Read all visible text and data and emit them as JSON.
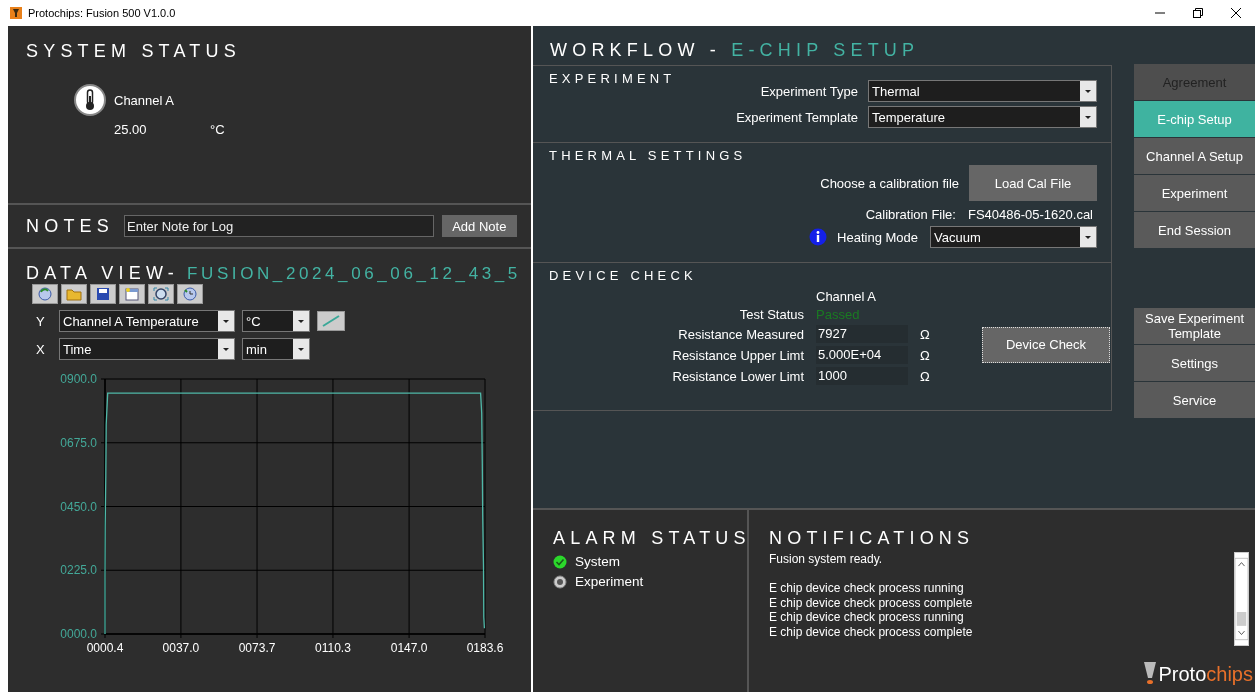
{
  "window": {
    "title": "Protochips: Fusion 500 V1.0.0"
  },
  "system_status": {
    "title": "SYSTEM STATUS",
    "channels": [
      {
        "name": "Channel A",
        "value": "25.00",
        "unit": "°C"
      }
    ]
  },
  "notes": {
    "title": "NOTES",
    "placeholder": "Enter Note for Log",
    "button": "Add Note"
  },
  "data_view": {
    "title": "DATA VIEW-",
    "file": "FUSION_2024_06_06_12_43_5",
    "y_axis": {
      "label": "Y",
      "quantity": "Channel A Temperature",
      "unit": "°C"
    },
    "x_axis": {
      "label": "X",
      "quantity": "Time",
      "unit": "min"
    },
    "chart_data": {
      "type": "line",
      "x": [
        0.4,
        0.4,
        0.5,
        0.8,
        1.0,
        1.7,
        181.5,
        182.0,
        182.3,
        182.5,
        182.9,
        183.0,
        183.3
      ],
      "grid": true,
      "series": [
        {
          "color": "#4fb8a8",
          "values": [
            0,
            200,
            380,
            560,
            740,
            850,
            850,
            780,
            600,
            420,
            240,
            60,
            20
          ]
        }
      ],
      "xlim": [
        0.4,
        183.6
      ],
      "ylim": [
        0,
        900
      ],
      "xticks": [
        {
          "value": 0.4,
          "label": "0000.4"
        },
        {
          "value": 37.0,
          "label": "0037.0"
        },
        {
          "value": 73.7,
          "label": "0073.7"
        },
        {
          "value": 110.3,
          "label": "0110.3"
        },
        {
          "value": 147.0,
          "label": "0147.0"
        },
        {
          "value": 183.6,
          "label": "0183.6"
        }
      ],
      "yticks": [
        {
          "value": 0,
          "label": "0000.0"
        },
        {
          "value": 225,
          "label": "0225.0"
        },
        {
          "value": 450,
          "label": "0450.0"
        },
        {
          "value": 675,
          "label": "0675.0"
        },
        {
          "value": 900,
          "label": "0900.0"
        }
      ]
    }
  },
  "workflow": {
    "title": "WORKFLOW - ",
    "step": "E-CHIP SETUP",
    "experiment": {
      "title": "EXPERIMENT",
      "fields": [
        {
          "label": "Experiment Type",
          "value": "Thermal"
        },
        {
          "label": "Experiment Template",
          "value": "Temperature"
        }
      ]
    },
    "thermal": {
      "title": "THERMAL SETTINGS",
      "prompt": "Choose a calibration file",
      "button": "Load Cal File",
      "file_label": "Calibration File:",
      "file": "FS40486-05-1620.cal",
      "mode_label": "Heating Mode",
      "mode": "Vacuum"
    },
    "device_check": {
      "title": "DEVICE CHECK",
      "channel": "Channel A",
      "status_label": "Test Status",
      "status": {
        "text": "Passed",
        "passed": true
      },
      "readings": [
        {
          "label": "Resistance Measured",
          "value": "7927",
          "unit": "Ω"
        },
        {
          "label": "Resistance Upper Limt",
          "value": "5.000E+04",
          "unit": "Ω"
        },
        {
          "label": "Resistance Lower Limt",
          "value": "1000",
          "unit": "Ω"
        }
      ],
      "button": "Device Check"
    }
  },
  "steps": [
    {
      "label": "Agreement",
      "selected": false,
      "disabled": true
    },
    {
      "label": "E-chip Setup",
      "selected": true,
      "disabled": false
    },
    {
      "label": "Channel A Setup",
      "selected": false,
      "disabled": false
    },
    {
      "label": "Experiment",
      "selected": false,
      "disabled": false
    },
    {
      "label": "End Session",
      "selected": false,
      "disabled": false
    }
  ],
  "actions": [
    "Save Experiment Template",
    "Settings",
    "Service"
  ],
  "alarm_status": {
    "title": "ALARM STATUS",
    "alarms": [
      {
        "label": "System",
        "ok": true
      },
      {
        "label": "Experiment",
        "ok": false
      }
    ]
  },
  "notifications": {
    "title": "NOTIFICATIONS",
    "groups": [
      [
        "Fusion system ready."
      ],
      [
        "E chip device check process running",
        "E chip device check process complete",
        "E chip device check process running",
        "E chip device check process complete"
      ]
    ]
  },
  "logo": [
    "Proto",
    "chips"
  ]
}
